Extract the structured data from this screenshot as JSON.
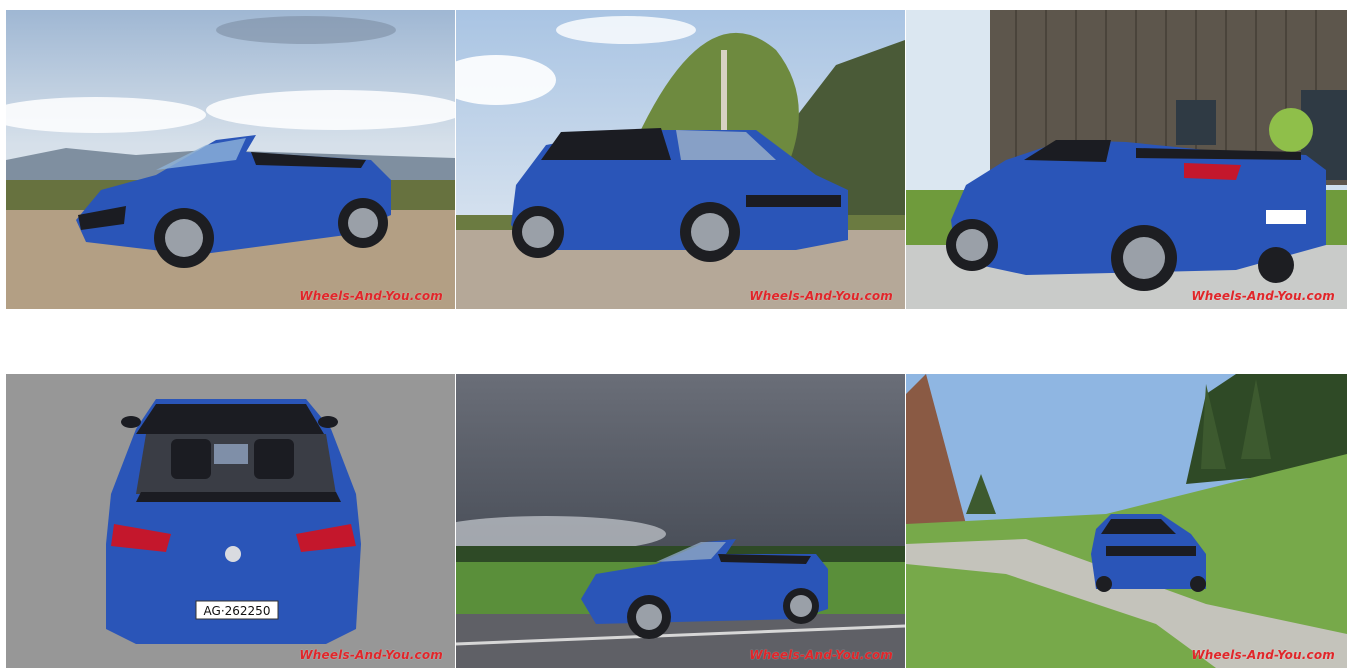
{
  "gallery": {
    "watermark": "Wheels-And-You.com",
    "colors": {
      "car_blue": "#2a55b8",
      "car_blue_dark": "#163a8c",
      "soft_top_black": "#1b1c22",
      "watermark_red": "#e0262a"
    },
    "plates": {
      "rear_plate": "AG·262250"
    }
  }
}
